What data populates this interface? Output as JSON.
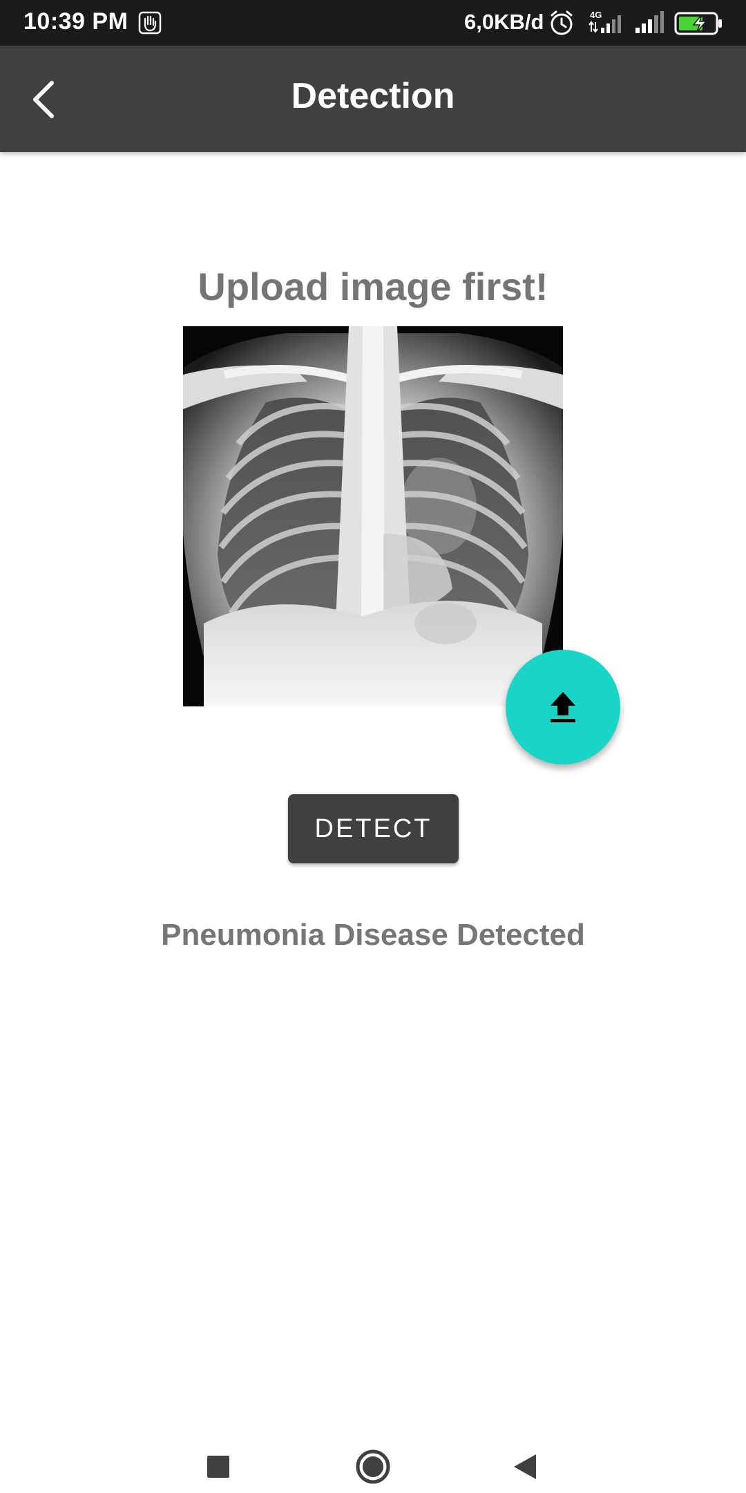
{
  "status_bar": {
    "time": "10:39 PM",
    "network_speed": "6,0KB/d",
    "network_type": "4G",
    "icons": [
      "hand-icon",
      "alarm-icon",
      "signal-4g-icon",
      "signal-icon",
      "battery-charging-icon"
    ]
  },
  "app_bar": {
    "title": "Detection",
    "back_icon": "chevron-left-icon"
  },
  "main": {
    "upload_heading": "Upload image first!",
    "image_description_icon": "chest-xray-image",
    "upload_fab_icon": "upload-icon",
    "detect_label": "DETECT",
    "result": "Pneumonia Disease Detected"
  },
  "nav_bar": {
    "icons": [
      "recents-icon",
      "home-icon",
      "back-triangle-icon"
    ]
  },
  "colors": {
    "status_bar": "#1b1b1b",
    "app_bar": "#404040",
    "fab": "#19d5c5",
    "button": "#404040",
    "heading_text": "#747474"
  }
}
